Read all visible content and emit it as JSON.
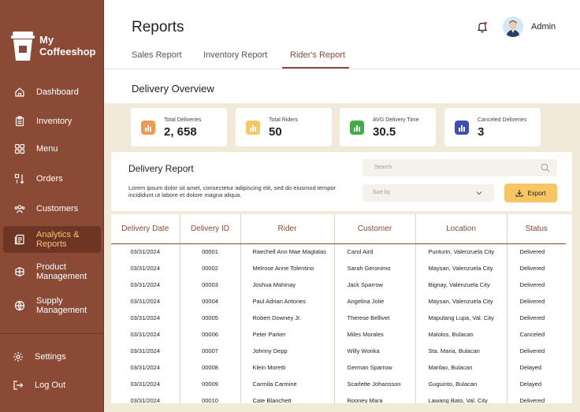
{
  "brand": {
    "line1": "My",
    "line2": "Coffeeshop"
  },
  "nav": [
    {
      "label": "Dashboard",
      "icon": "home-icon"
    },
    {
      "label": "Inventory",
      "icon": "clipboard-icon"
    },
    {
      "label": "Menu",
      "icon": "grid-icon"
    },
    {
      "label": "Orders",
      "icon": "sort-icon"
    },
    {
      "label": "Customers",
      "icon": "users-icon"
    },
    {
      "label": "Analytics & Reports",
      "icon": "report-icon",
      "active": true
    },
    {
      "label": "Product Management",
      "icon": "package-icon"
    },
    {
      "label": "Supply Management",
      "icon": "globe-icon"
    },
    {
      "label": "Settings",
      "icon": "gear-icon"
    },
    {
      "label": "Log Out",
      "icon": "logout-icon"
    }
  ],
  "header": {
    "title": "Reports",
    "user": "Admin"
  },
  "tabs": [
    {
      "label": "Sales Report"
    },
    {
      "label": "Inventory Report"
    },
    {
      "label": "Rider's Report",
      "active": true
    }
  ],
  "overview": {
    "title": "Delivery Overview",
    "cards": [
      {
        "label": "Total Deliveries",
        "value": "2, 658",
        "color": "#ee9a50"
      },
      {
        "label": "Total Riders",
        "value": "50",
        "color": "#f6c866"
      },
      {
        "label": "AVG Delivery Time",
        "value": "30.5",
        "color": "#3fae46"
      },
      {
        "label": "Canceled Deliveries",
        "value": "3",
        "color": "#3d4fb8"
      }
    ]
  },
  "report": {
    "title": "Delivery Report",
    "description": "Lorem ipsum dolor sit amet, consectetur adipiscing elit, sed do eiusmod tempor incididunt ut labore et dolore magna aliqua.",
    "search_placeholder": "Search",
    "sort_placeholder": "Sort by",
    "export_label": "Export"
  },
  "table": {
    "columns": [
      "Delivery Date",
      "Delivery ID",
      "Rider",
      "Customer",
      "Location",
      "Status"
    ],
    "rows": [
      [
        "03/31/2024",
        "00001",
        "Raechell Ann Mae Magtalas",
        "Carol Aird",
        "Punturin, Valenzuela City",
        "Delivered"
      ],
      [
        "03/31/2024",
        "00002",
        "Melrose Anne Tolentino",
        "Sarah Geronimo",
        "Maysan, Valenzuela City",
        "Delivered"
      ],
      [
        "03/31/2024",
        "00003",
        "Joshua Mahinay",
        "Jack Sparrow",
        "Bignay, Valenzuela City",
        "Delivered"
      ],
      [
        "03/31/2024",
        "00004",
        "Paul Adrian Antones",
        "Angelina Jolie",
        "Maysan, Valenzuela City",
        "Delivered"
      ],
      [
        "03/31/2024",
        "00005",
        "Robert Downey Jr.",
        "Therese Bellivet",
        "Mapulang Lupa, Val. City",
        "Delivered"
      ],
      [
        "03/31/2024",
        "00006",
        "Peter Parker",
        "Miles Morales",
        "Malolos, Bulacan",
        "Canceled"
      ],
      [
        "03/31/2024",
        "00007",
        "Johnny Depp",
        "Willy Wonka",
        "Sta. Maria, Bulacan",
        "Delivered"
      ],
      [
        "03/31/2024",
        "00008",
        "Klein Moretti",
        "German Sparrow",
        "Marilao, Bulacan",
        "Delayed"
      ],
      [
        "03/31/2024",
        "00009",
        "Carmila Carmine",
        "Scarlette Johansson",
        "Guguinto, Bulacan",
        "Delayed"
      ],
      [
        "03/31/2024",
        "00010",
        "Cate Blanchett",
        "Rooney Mara",
        "Lawang Bato, Val. City",
        "Delivered"
      ]
    ]
  }
}
